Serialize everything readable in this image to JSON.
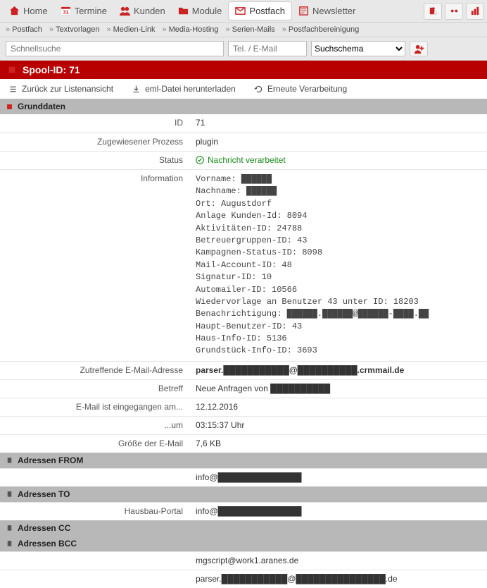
{
  "topnav": {
    "items": [
      {
        "label": "Home",
        "icon": "home"
      },
      {
        "label": "Termine",
        "icon": "calendar"
      },
      {
        "label": "Kunden",
        "icon": "users"
      },
      {
        "label": "Module",
        "icon": "folder"
      },
      {
        "label": "Postfach",
        "icon": "mail",
        "active": true
      },
      {
        "label": "Newsletter",
        "icon": "newsletter"
      }
    ]
  },
  "subnav": {
    "items": [
      "Postfach",
      "Textvorlagen",
      "Medien-Link",
      "Media-Hosting",
      "Serien-Mails",
      "Postfachbereinigung"
    ]
  },
  "search": {
    "quick_placeholder": "Schnellsuche",
    "tel_placeholder": "Tel. / E-Mail",
    "scheme_label": "Suchschema"
  },
  "titlebar": {
    "text": "Spool-ID: 71"
  },
  "actions": {
    "back": "Zurück zur Listenansicht",
    "download": "eml-Datei herunterladen",
    "reprocess": "Erneute Verarbeitung"
  },
  "sections": {
    "grunddaten": "Grunddaten",
    "from": "Adressen FROM",
    "to": "Adressen TO",
    "cc": "Adressen CC",
    "bcc": "Adressen BCC"
  },
  "grunddaten": {
    "id_label": "ID",
    "id_val": "71",
    "proc_label": "Zugewiesener Prozess",
    "proc_val": "plugin",
    "status_label": "Status",
    "status_val": "Nachricht verarbeitet",
    "info_label": "Information",
    "info_val": "Vorname: ██████\nNachname: ██████\nOrt: Augustdorf\nAnlage Kunden-Id: 8094\nAktivitäten-ID: 24788\nBetreuergruppen-ID: 43\nKampagnen-Status-ID: 8098\nMail-Account-ID: 48\nSignatur-ID: 10\nAutomailer-ID: 10566\nWiedervorlage an Benutzer 43 unter ID: 18203\nBenachrichtigung: ██████.██████@██████-████.██\nHaupt-Benutzer-ID: 43\nHaus-Info-ID: 5136\nGrundstück-Info-ID: 3693",
    "email_label": "Zutreffende E-Mail-Adresse",
    "email_val": "parser.███████████@██████████.crmmail.de",
    "betreff_label": "Betreff",
    "betreff_val": "Neue Anfragen von ██████████",
    "date_label": "E-Mail ist eingegangen am...",
    "date_val": "12.12.2016",
    "time_label": "...um",
    "time_val": "03:15:37 Uhr",
    "size_label": "Größe der E-Mail",
    "size_val": "7,6 KB"
  },
  "addr": {
    "from_val": "info@██████████████",
    "to_label": "Hausbau-Portal",
    "to_val": "info@██████████████",
    "bcc1": "mgscript@work1.aranes.de",
    "bcc2": "parser.███████████@███████████████.de"
  }
}
